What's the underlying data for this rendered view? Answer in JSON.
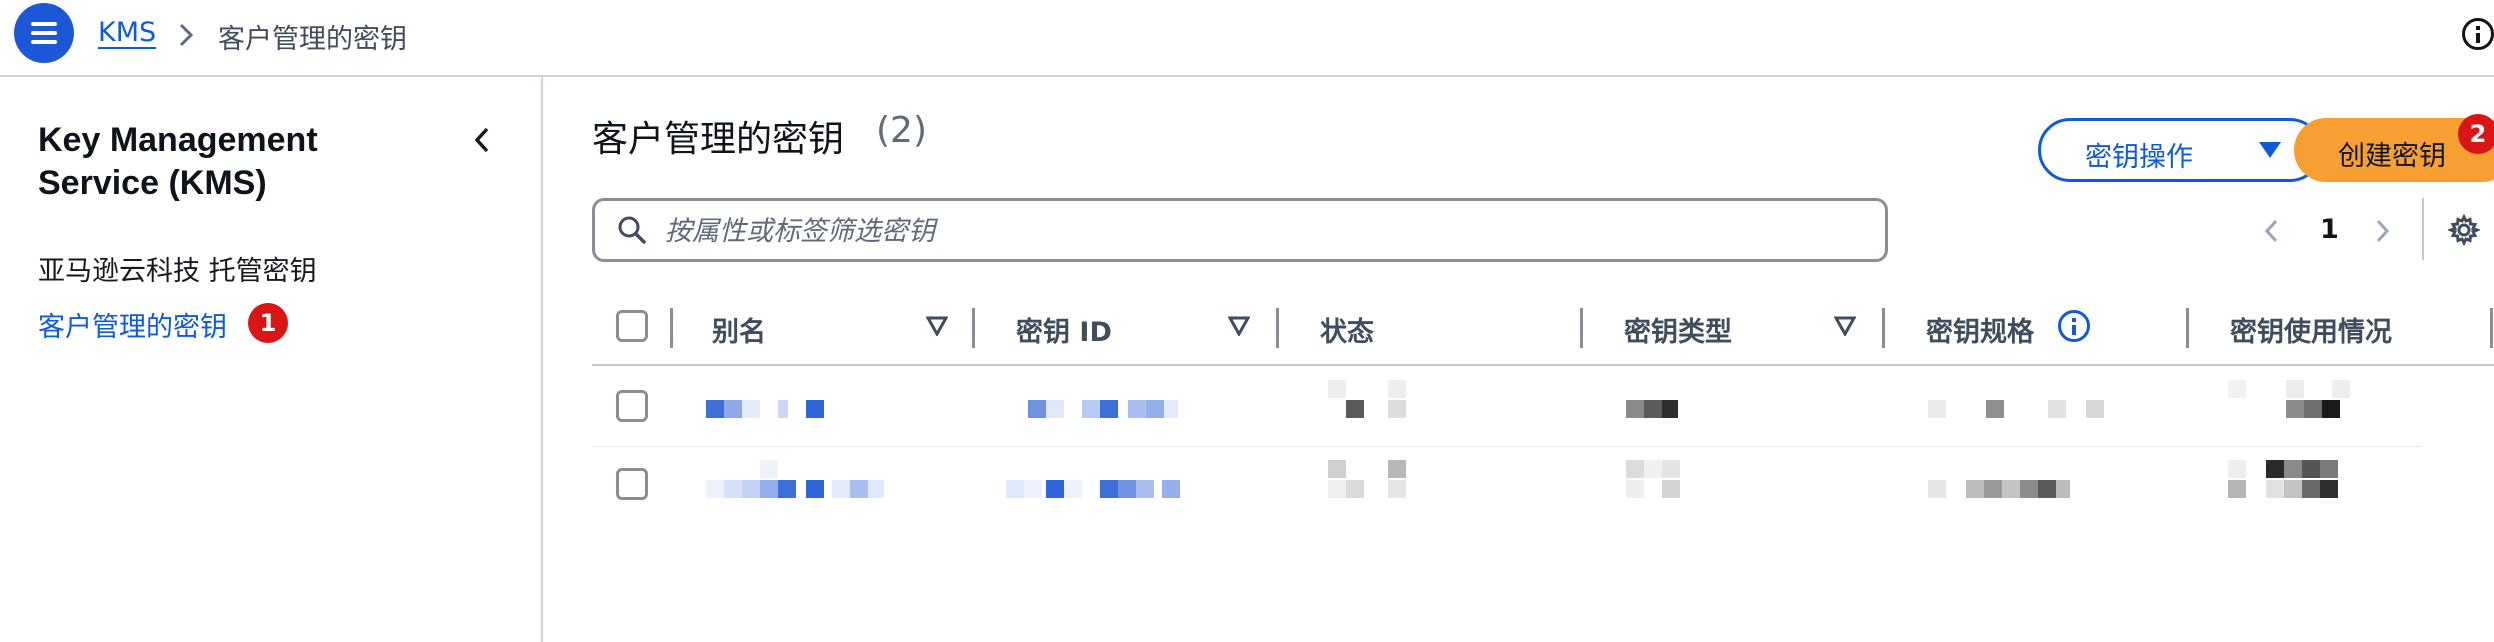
{
  "topbar": {
    "breadcrumb_root": "KMS",
    "breadcrumb_current": "客户管理的密钥"
  },
  "sidebar": {
    "title": "Key Management Service (KMS)",
    "items": [
      {
        "label": "亚马逊云科技 托管密钥"
      },
      {
        "label": "客户管理的密钥",
        "badge": "1"
      }
    ]
  },
  "main": {
    "title": "客户管理的密钥",
    "count": "(2)",
    "actions_button": "密钥操作",
    "create_button": "创建密钥",
    "create_badge": "2",
    "search_placeholder": "按属性或标签筛选密钥",
    "page": "1"
  },
  "table": {
    "columns": [
      "别名",
      "密钥 ID",
      "状态",
      "密钥类型",
      "密钥规格",
      "密钥使用情况"
    ]
  },
  "colors": {
    "link": "#0f5bd6",
    "primary_button": "#f89f33",
    "badge": "#d91515",
    "menu_button": "#1b57d6"
  }
}
